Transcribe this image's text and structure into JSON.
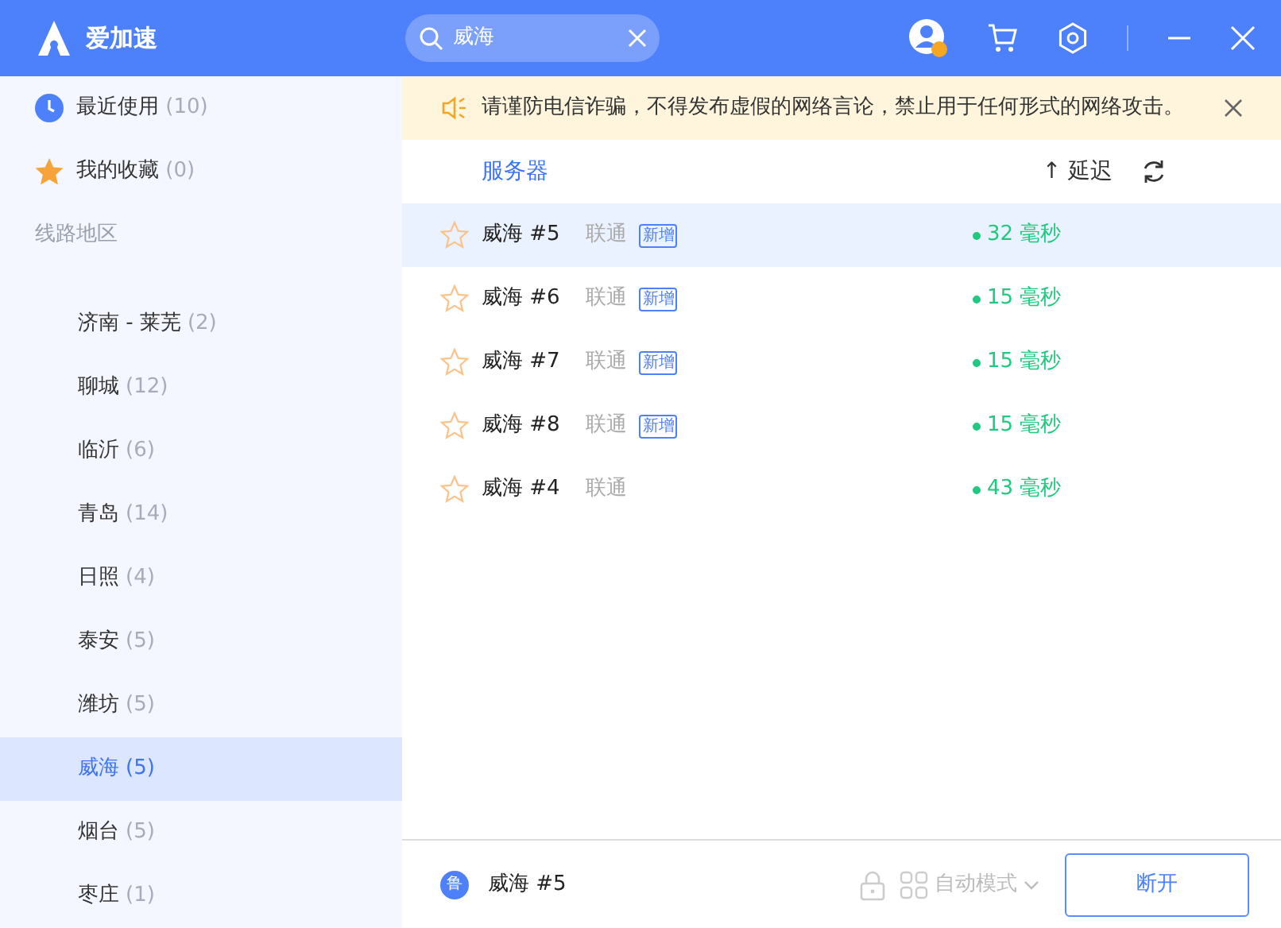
{
  "app": {
    "name": "爱加速"
  },
  "search": {
    "value": "威海"
  },
  "sidebar": {
    "top_items": [
      {
        "kind": "recent",
        "label": "最近使用",
        "count": "(10)"
      },
      {
        "kind": "favorite",
        "label": "我的收藏",
        "count": "(0)"
      }
    ],
    "section_title": "线路地区",
    "regions": [
      {
        "label": "济南 - 莱芜",
        "count": "(2)",
        "selected": false
      },
      {
        "label": "聊城",
        "count": "(12)",
        "selected": false
      },
      {
        "label": "临沂",
        "count": "(6)",
        "selected": false
      },
      {
        "label": "青岛",
        "count": "(14)",
        "selected": false
      },
      {
        "label": "日照",
        "count": "(4)",
        "selected": false
      },
      {
        "label": "泰安",
        "count": "(5)",
        "selected": false
      },
      {
        "label": "潍坊",
        "count": "(5)",
        "selected": false
      },
      {
        "label": "威海",
        "count": "(5)",
        "selected": true
      },
      {
        "label": "烟台",
        "count": "(5)",
        "selected": false
      },
      {
        "label": "枣庄",
        "count": "(1)",
        "selected": false
      }
    ]
  },
  "notice": "请谨防电信诈骗，不得发布虚假的网络言论，禁止用于任何形式的网络攻击。",
  "table": {
    "columns": [
      "服务器",
      "↑ 延迟"
    ],
    "rows": [
      {
        "name": "威海 #5",
        "isp": "联通",
        "tag": "新增",
        "latency": "32 毫秒",
        "selected": true
      },
      {
        "name": "威海 #6",
        "isp": "联通",
        "tag": "新增",
        "latency": "15 毫秒",
        "selected": false
      },
      {
        "name": "威海 #7",
        "isp": "联通",
        "tag": "新增",
        "latency": "15 毫秒",
        "selected": false
      },
      {
        "name": "威海 #8",
        "isp": "联通",
        "tag": "新增",
        "latency": "15 毫秒",
        "selected": false
      },
      {
        "name": "威海 #4",
        "isp": "联通",
        "latency": "43 毫秒",
        "selected": false
      }
    ]
  },
  "status_bar": {
    "region_badge": "鲁",
    "server": "威海 #5",
    "mode": "自动模式",
    "button": "断开"
  }
}
